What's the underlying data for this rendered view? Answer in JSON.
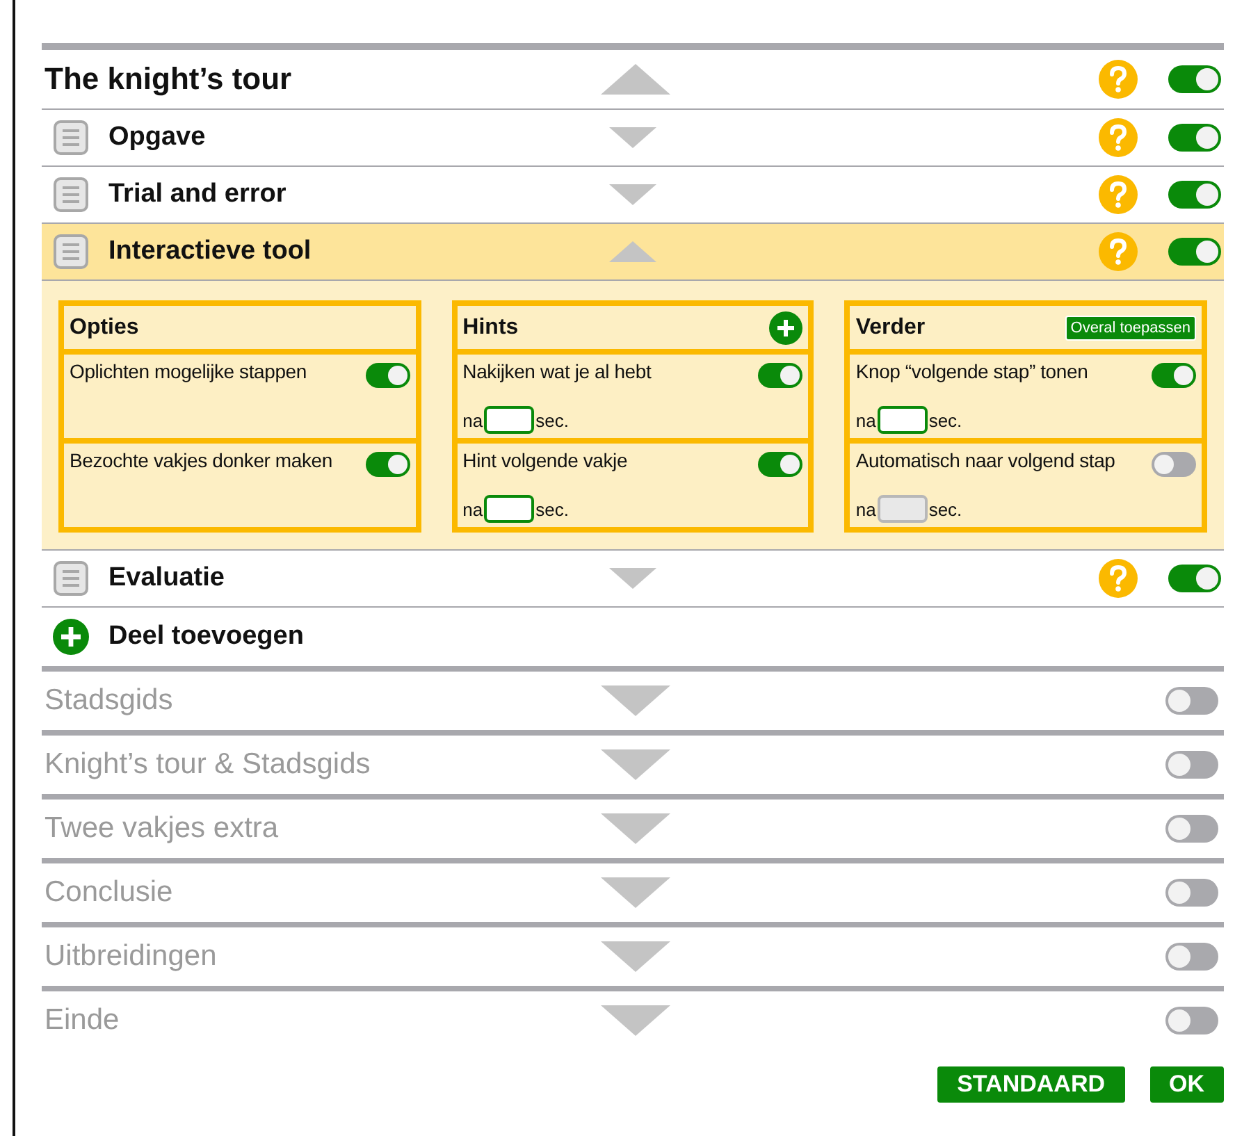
{
  "tour": {
    "title": "The knight’s tour",
    "expanded": true,
    "on": true
  },
  "parts": [
    {
      "title": "Opgave",
      "expanded": false,
      "on": true
    },
    {
      "title": "Trial and error",
      "expanded": false,
      "on": true
    },
    {
      "title": "Interactieve tool",
      "expanded": true,
      "on": true,
      "groups": [
        {
          "title": "Opties",
          "options": [
            {
              "label": "Oplichten mogelijke stappen",
              "on": true
            },
            {
              "label": "Bezochte vakjes donker maken",
              "on": true
            }
          ]
        },
        {
          "title": "Hints",
          "action": {
            "kind": "add"
          },
          "options": [
            {
              "label": "Nakijken wat je al hebt",
              "on": true,
              "delay": {
                "prefix": "na",
                "suffix": "sec.",
                "disabled": false
              }
            },
            {
              "label": "Hint volgende vakje",
              "on": true,
              "delay": {
                "prefix": "na",
                "suffix": "sec.",
                "disabled": false
              }
            }
          ]
        },
        {
          "title": "Verder",
          "action": {
            "kind": "button",
            "label": "Overal toepassen"
          },
          "options": [
            {
              "label": "Knop “volgende stap” tonen",
              "on": true,
              "delay": {
                "prefix": "na",
                "suffix": "sec.",
                "disabled": false
              }
            },
            {
              "label": "Automatisch naar volgend stap",
              "on": false,
              "delay": {
                "prefix": "na",
                "suffix": "sec.",
                "disabled": true
              }
            }
          ]
        }
      ]
    },
    {
      "title": "Evaluatie",
      "expanded": false,
      "on": true
    }
  ],
  "add_part": "Deel toevoegen",
  "sections": [
    {
      "title": "Stadsgids",
      "expanded": false,
      "on": false
    },
    {
      "title": "Knight’s tour & Stadsgids",
      "expanded": false,
      "on": false
    },
    {
      "title": "Twee vakjes extra",
      "expanded": false,
      "on": false
    },
    {
      "title": "Conclusie",
      "expanded": false,
      "on": false
    },
    {
      "title": "Uitbreidingen",
      "expanded": false,
      "on": false
    },
    {
      "title": "Einde",
      "expanded": false,
      "on": false
    }
  ],
  "buttons": [
    "STANDAARD",
    "OK"
  ]
}
